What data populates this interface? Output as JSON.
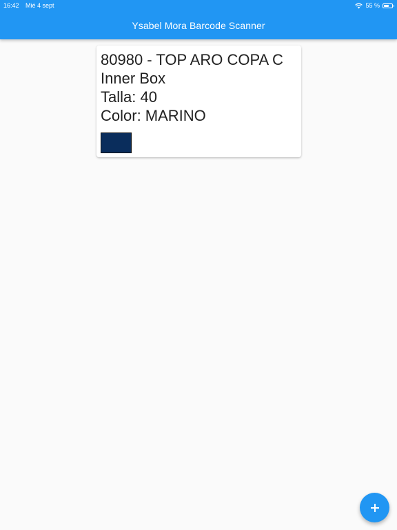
{
  "status_bar": {
    "time": "16:42",
    "date": "Mié 4 sept",
    "battery_percent_label": "55 %",
    "battery_level": 0.55,
    "icons": [
      "wifi-icon",
      "battery-icon"
    ]
  },
  "app_bar": {
    "title": "Ysabel Mora Barcode Scanner",
    "color": "#2196f3"
  },
  "items": [
    {
      "title": "80980 - TOP ARO COPA C",
      "package": "Inner Box",
      "size": "Talla: 40",
      "color_label": "Color: MARINO",
      "swatch_color": "#0a2d5c"
    }
  ],
  "fab": {
    "icon": "plus-icon",
    "color": "#2196f3"
  }
}
